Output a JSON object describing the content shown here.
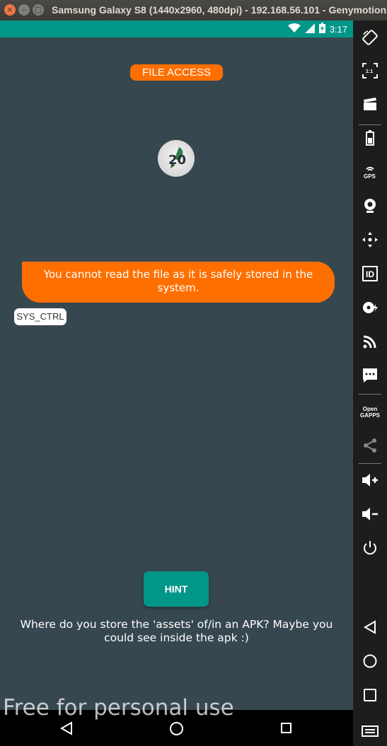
{
  "window": {
    "title": "Samsung Galaxy S8 (1440x2960, 480dpi) - 192.168.56.101 - Genymotion",
    "close_glyph": "×",
    "minimize_glyph": "–",
    "maximize_glyph": "□"
  },
  "statusbar": {
    "time": "3:17",
    "battery_icon": "battery-charging-icon",
    "wifi_icon": "wifi-icon",
    "signal_icon": "signal-icon"
  },
  "app": {
    "header_badge": "FILE ACCESS",
    "logo_text": "20",
    "message": "You cannot read the file as it is safely stored in the system.",
    "sender_tag": "SYS_CTRL",
    "hint_button": "HINT",
    "hint_text": "Where do you store the 'assets' of/in an APK? Maybe you could see inside the apk :)"
  },
  "watermark": "Free for personal use",
  "toolbar": {
    "items": [
      {
        "icon": "rotate-icon"
      },
      {
        "icon": "pixel-perfect-icon",
        "label": "1:1"
      },
      {
        "icon": "capture-icon"
      },
      {
        "icon": "battery-icon"
      },
      {
        "icon": "gps-icon",
        "label": "GPS"
      },
      {
        "icon": "camera-icon"
      },
      {
        "icon": "dpad-icon"
      },
      {
        "icon": "identifiers-icon",
        "label": "ID"
      },
      {
        "icon": "disk-io-icon"
      },
      {
        "icon": "network-icon"
      },
      {
        "icon": "sms-icon"
      },
      {
        "icon": "open-gapps-icon",
        "label": "Open GAPPS"
      },
      {
        "icon": "share-icon"
      },
      {
        "icon": "volume-up-icon"
      },
      {
        "icon": "volume-down-icon"
      },
      {
        "icon": "power-icon"
      },
      {
        "icon": "back-icon"
      },
      {
        "icon": "home-icon"
      },
      {
        "icon": "recent-apps-icon"
      },
      {
        "icon": "menu-icon"
      }
    ]
  },
  "colors": {
    "accent_orange": "#ff6f00",
    "teal": "#009688",
    "screen_bg": "#37474f"
  }
}
